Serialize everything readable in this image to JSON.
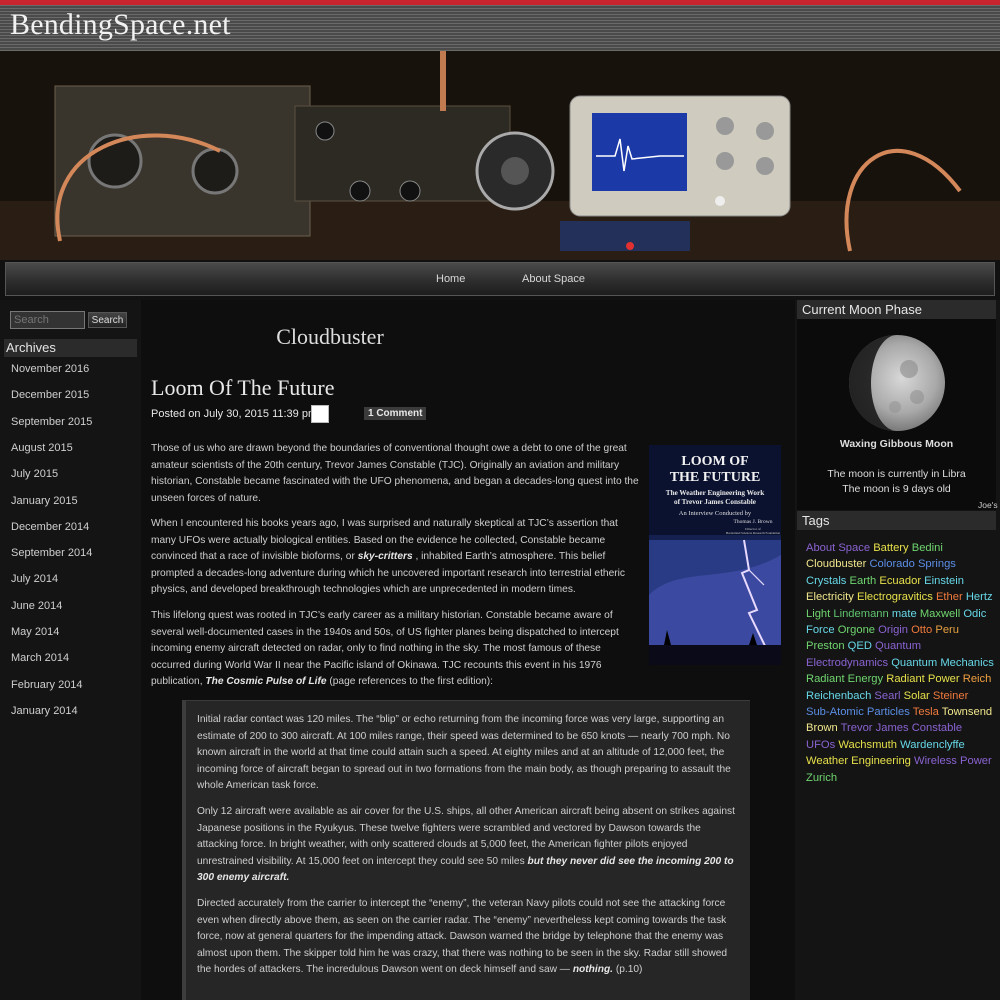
{
  "site": {
    "title": "BendingSpace.net"
  },
  "nav": {
    "home": "Home",
    "about": "About Space"
  },
  "search": {
    "placeholder": "Search",
    "button": "Search"
  },
  "archives": {
    "title": "Archives",
    "items": [
      "November 2016",
      "December 2015",
      "September 2015",
      "August 2015",
      "July 2015",
      "January 2015",
      "December 2014",
      "September 2014",
      "July 2014",
      "June 2014",
      "May 2014",
      "March 2014",
      "February 2014",
      "January 2014"
    ]
  },
  "main": {
    "category_title": "Cloudbuster",
    "post_title": "Loom Of The Future",
    "posted_on": "Posted on July 30, 2015 11:39 pm",
    "comments": "1 Comment",
    "p1": "Those of us who are drawn beyond the boundaries of conventional thought owe a debt to one of the great amateur scientists of the 20th century, Trevor James Constable (TJC). Originally an aviation and military historian, Constable became fascinated with the UFO phenomena, and began a decades-long quest into the unseen forces of nature.",
    "p2_a": "When I encountered his books years ago, I was surprised and naturally skeptical at TJC’s assertion that many UFOs were actually biological entities. Based on the evidence he collected, Constable became convinced that a race of invisible bioforms, or ",
    "p2_em": "sky-critters",
    "p2_b": " , inhabited Earth’s atmosphere. This belief prompted a decades-long adventure during which he uncovered important research into terrestrial etheric physics, and developed breakthrough technologies which are unprecedented in modern times.",
    "p3_a": "This lifelong quest was rooted in TJC’s early career as a military historian. Constable became aware of several well-documented cases in the 1940s and 50s, of US fighter planes being dispatched to intercept incoming enemy aircraft detected on radar, only to find nothing in the sky. The most famous of these occurred during World War II near the Pacific island of Okinawa. TJC recounts this event in his 1976 publication, ",
    "p3_em": "The Cosmic Pulse of Life",
    "p3_b": "  (page references to the first edition):",
    "q1": "Initial radar contact was 120 miles. The “blip” or echo returning from the incoming force was very large, supporting an estimate of 200 to 300 aircraft. At 100 miles range, their speed was determined to be 650 knots — nearly 700 mph. No known aircraft in the world at that time could attain such a speed. At eighty miles and at an altitude of 12,000 feet, the incoming force of aircraft began to spread out in two formations from the main body, as though preparing to assault the whole American task force.",
    "q2_a": "Only 12 aircraft were available as air cover for the U.S. ships, all other American aircraft being absent on strikes against Japanese positions in the Ryukyus. These twelve fighters were scrambled and vectored by Dawson towards the attacking force. In bright weather, with only scattered clouds at 5,000 feet, the American fighter pilots enjoyed unrestrained visibility. At 15,000 feet on intercept they could see 50 miles ",
    "q2_em": "but they never did see the incoming 200 to 300 enemy aircraft.",
    "q3_a": "Directed accurately from the carrier to intercept the “enemy”, the veteran Navy pilots could not see the attacking force even when directly above them, as seen on the carrier radar. The “enemy” nevertheless kept coming towards the task force, now at general quarters for the impending attack. Dawson warned the bridge by telephone that the enemy was almost upon them. The skipper told him he was crazy, that there was nothing to be seen in the sky. Radar still showed the hordes of attackers. The incredulous Dawson went on deck himself and saw — ",
    "q3_em": "nothing.",
    "q3_b": "  (p.10)",
    "book": {
      "title_l1": "LOOM OF",
      "title_l2": "THE FUTURE",
      "subtitle_l1": "The Weather Engineering Work",
      "subtitle_l2": "of Trevor James Constable",
      "interview_l1": "An Interview Conducted by",
      "interview_l2": "Thomas J. Brown",
      "small_l1": "Director of",
      "small_l2": "Borderland Sciences Research Foundation"
    }
  },
  "moon": {
    "title": "Current Moon Phase",
    "phase": "Waxing Gibbous Moon",
    "line1": "The moon is currently in Libra",
    "line2": "The moon is 9 days old",
    "credit": "Joe's"
  },
  "tags": {
    "title": "Tags",
    "items": [
      {
        "label": "About Space",
        "color": "#8a63d2"
      },
      {
        "label": "Battery",
        "color": "#e6e04a"
      },
      {
        "label": "Bedini",
        "color": "#6fd66f"
      },
      {
        "label": "Cloudbuster",
        "color": "#f0e68c"
      },
      {
        "label": "Colorado Springs",
        "color": "#5b8ee6"
      },
      {
        "label": "Crystals",
        "color": "#67d8e8"
      },
      {
        "label": "Earth",
        "color": "#6fd66f"
      },
      {
        "label": "Ecuador",
        "color": "#e6e04a"
      },
      {
        "label": "Einstein",
        "color": "#67d8e8"
      },
      {
        "label": "Electricity",
        "color": "#f0e68c"
      },
      {
        "label": "Electrogravitics",
        "color": "#e6e04a"
      },
      {
        "label": "Ether",
        "color": "#f07a3c"
      },
      {
        "label": "Hertz",
        "color": "#67d8e8"
      },
      {
        "label": "Light",
        "color": "#6fd66f"
      },
      {
        "label": "Lindemann",
        "color": "#5fc46f"
      },
      {
        "label": "mate",
        "color": "#67d8e8"
      },
      {
        "label": "Maxwell",
        "color": "#6fd66f"
      },
      {
        "label": "Odic Force",
        "color": "#67d8e8"
      },
      {
        "label": "Orgone",
        "color": "#6fd66f"
      },
      {
        "label": "Origin",
        "color": "#8a63d2"
      },
      {
        "label": "Otto",
        "color": "#f07a3c"
      },
      {
        "label": "Peru",
        "color": "#e6a040"
      },
      {
        "label": "Preston",
        "color": "#6fd66f"
      },
      {
        "label": "QED",
        "color": "#67d8e8"
      },
      {
        "label": "Quantum Electrodynamics",
        "color": "#8a63d2"
      },
      {
        "label": "Quantum Mechanics",
        "color": "#67d8e8"
      },
      {
        "label": "Radiant Energy",
        "color": "#6fd66f"
      },
      {
        "label": "Radiant Power",
        "color": "#e6e04a"
      },
      {
        "label": "Reich",
        "color": "#f0a040"
      },
      {
        "label": "Reichenbach",
        "color": "#67d8e8"
      },
      {
        "label": "Searl",
        "color": "#8a63d2"
      },
      {
        "label": "Solar",
        "color": "#e6e04a"
      },
      {
        "label": "Steiner",
        "color": "#f07a3c"
      },
      {
        "label": "Sub-Atomic Particles",
        "color": "#5b8ee6"
      },
      {
        "label": "Tesla",
        "color": "#f07a3c"
      },
      {
        "label": "Townsend Brown",
        "color": "#f0e68c"
      },
      {
        "label": "Trevor James Constable",
        "color": "#8a63d2"
      },
      {
        "label": "UFOs",
        "color": "#8a63d2"
      },
      {
        "label": "Wachsmuth",
        "color": "#e6e04a"
      },
      {
        "label": "Wardenclyffe",
        "color": "#67d8e8"
      },
      {
        "label": "Weather Engineering",
        "color": "#e6e04a"
      },
      {
        "label": "Wireless Power",
        "color": "#8a63d2"
      },
      {
        "label": "Zurich",
        "color": "#6fd66f"
      }
    ]
  }
}
